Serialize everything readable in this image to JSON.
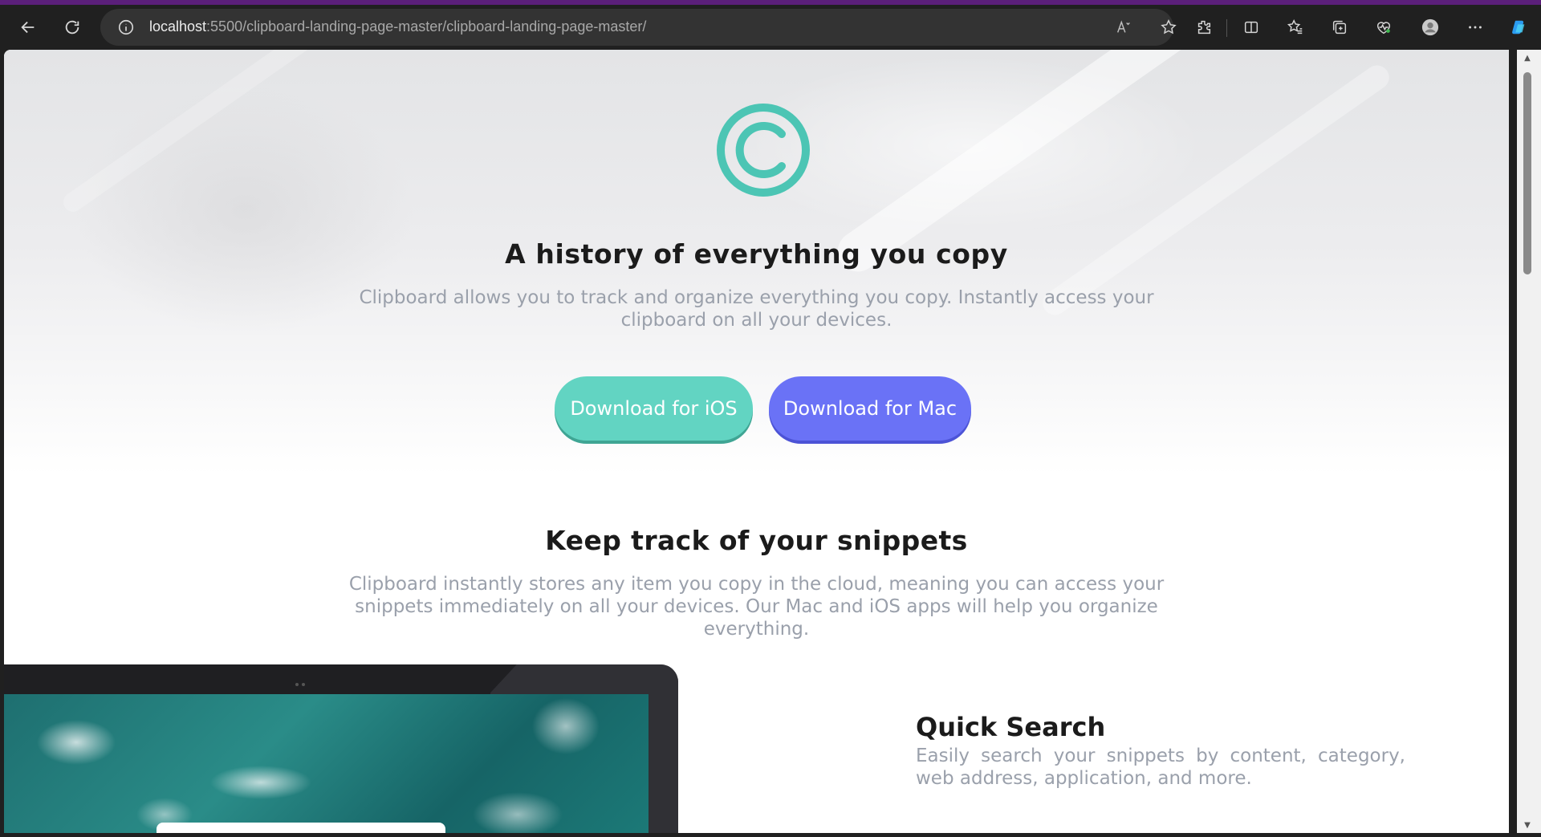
{
  "browser": {
    "url_host": "localhost",
    "url_rest": ":5500/clipboard-landing-page-master/clipboard-landing-page-master/",
    "icons": [
      "back-icon",
      "refresh-icon",
      "info-icon",
      "read-aloud-icon",
      "favorite-star-icon",
      "extensions-icon",
      "split-screen-icon",
      "favorites-icon",
      "collections-icon",
      "browser-essentials-icon",
      "profile-icon",
      "more-icon",
      "copilot-icon"
    ],
    "accent": "#5b1f7a"
  },
  "hero": {
    "title": "A history of everything you copy",
    "description": "Clipboard allows you to track and organize everything you copy. Instantly access your clipboard on all your devices.",
    "ios_button": "Download for iOS",
    "mac_button": "Download for Mac",
    "logo_color": "#4cc5b4",
    "ios_color": "#62d4c2",
    "mac_color": "#6a72f6"
  },
  "snippets": {
    "title": "Keep track of your snippets",
    "description": "Clipboard instantly stores any item you copy in the cloud, meaning you can access your snippets immediately on all your devices. Our Mac and iOS apps will help you organize everything."
  },
  "features": [
    {
      "title": "Quick Search",
      "description": "Easily search your snippets by content, category, web address, application, and more."
    }
  ]
}
